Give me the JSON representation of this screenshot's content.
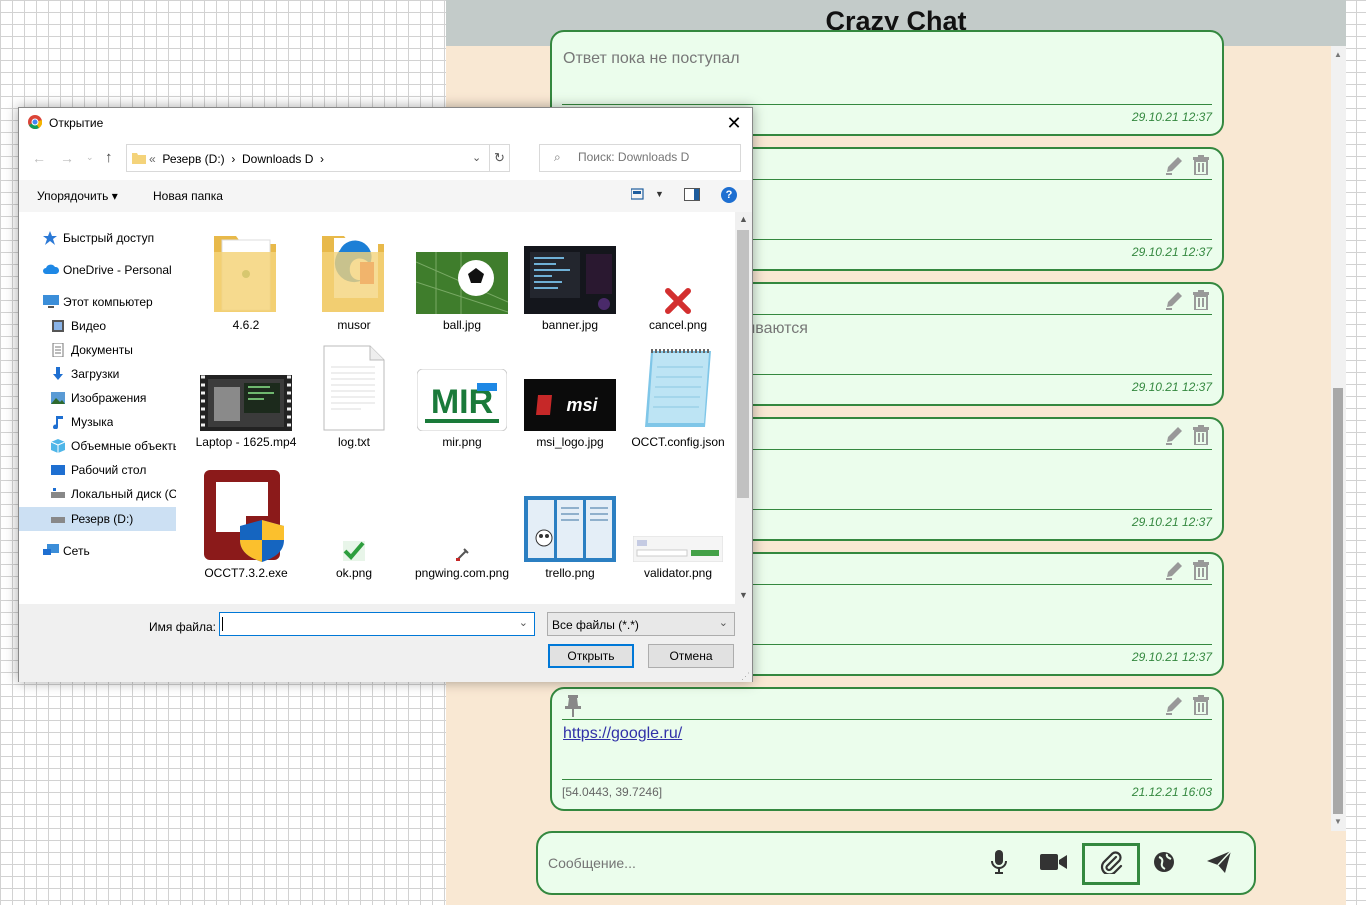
{
  "app": {
    "title": "Crazy Chat"
  },
  "messages": [
    {
      "body": "Ответ пока не поступал",
      "time": "29.10.21 12:37",
      "has_tools": false,
      "pinned": false
    },
    {
      "body": "",
      "time": "29.10.21 12:37",
      "has_tools": true,
      "pinned": false
    },
    {
      "body": "чиваются",
      "time": "29.10.21 12:37",
      "has_tools": true,
      "pinned": false
    },
    {
      "body": "",
      "time": "29.10.21 12:37",
      "has_tools": true,
      "pinned": false
    },
    {
      "body": "",
      "time": "29.10.21 12:37",
      "has_tools": true,
      "pinned": false
    },
    {
      "body": "https://google.ru/",
      "time": "21.12.21 16:03",
      "coords": "[54.0443, 39.7246]",
      "has_tools": true,
      "pinned": true
    }
  ],
  "composer": {
    "placeholder": "Сообщение...",
    "icons": [
      "microphone-icon",
      "video-camera-icon",
      "paperclip-icon",
      "globe-icon",
      "send-icon"
    ]
  },
  "dialog": {
    "title": "Открытие",
    "breadcrumb": [
      "Резерв (D:)",
      "Downloads D"
    ],
    "search_placeholder": "Поиск: Downloads D",
    "toolbar": {
      "organize": "Упорядочить",
      "new_folder": "Новая папка"
    },
    "nav": [
      {
        "label": "Быстрый доступ",
        "icon": "star-icon"
      },
      {
        "label": "OneDrive - Personal",
        "icon": "cloud-icon"
      },
      {
        "label": "Этот компьютер",
        "icon": "computer-icon"
      },
      {
        "label": "Видео",
        "icon": "video-icon"
      },
      {
        "label": "Документы",
        "icon": "document-icon"
      },
      {
        "label": "Загрузки",
        "icon": "download-icon"
      },
      {
        "label": "Изображения",
        "icon": "image-icon"
      },
      {
        "label": "Музыка",
        "icon": "music-icon"
      },
      {
        "label": "Объемные объекты",
        "icon": "cube-icon"
      },
      {
        "label": "Рабочий стол",
        "icon": "desktop-icon"
      },
      {
        "label": "Локальный диск (C:)",
        "icon": "drive-icon"
      },
      {
        "label": "Резерв (D:)",
        "icon": "drive-icon"
      },
      {
        "label": "Сеть",
        "icon": "network-icon"
      }
    ],
    "files": [
      {
        "name": "4.6.2",
        "kind": "folder"
      },
      {
        "name": "musor",
        "kind": "folder"
      },
      {
        "name": "ball.jpg",
        "kind": "image"
      },
      {
        "name": "banner.jpg",
        "kind": "image"
      },
      {
        "name": "cancel.png",
        "kind": "image"
      },
      {
        "name": "Laptop - 1625.mp4",
        "kind": "video"
      },
      {
        "name": "log.txt",
        "kind": "text"
      },
      {
        "name": "mir.png",
        "kind": "image"
      },
      {
        "name": "msi_logo.jpg",
        "kind": "image"
      },
      {
        "name": "OCCT.config.json",
        "kind": "notepad"
      },
      {
        "name": "OCCT7.3.2.exe",
        "kind": "exe"
      },
      {
        "name": "ok.png",
        "kind": "image"
      },
      {
        "name": "pngwing.com.png",
        "kind": "image"
      },
      {
        "name": "trello.png",
        "kind": "image"
      },
      {
        "name": "validator.png",
        "kind": "image"
      }
    ],
    "filename_label": "Имя файла:",
    "filename_value": "",
    "filter": "Все файлы (*.*)",
    "open_label": "Открыть",
    "cancel_label": "Отмена",
    "mir_text": "MIR",
    "msi_text": "msi",
    "colors": {
      "accent": "#0078d7",
      "chat_green": "#34883f"
    }
  }
}
